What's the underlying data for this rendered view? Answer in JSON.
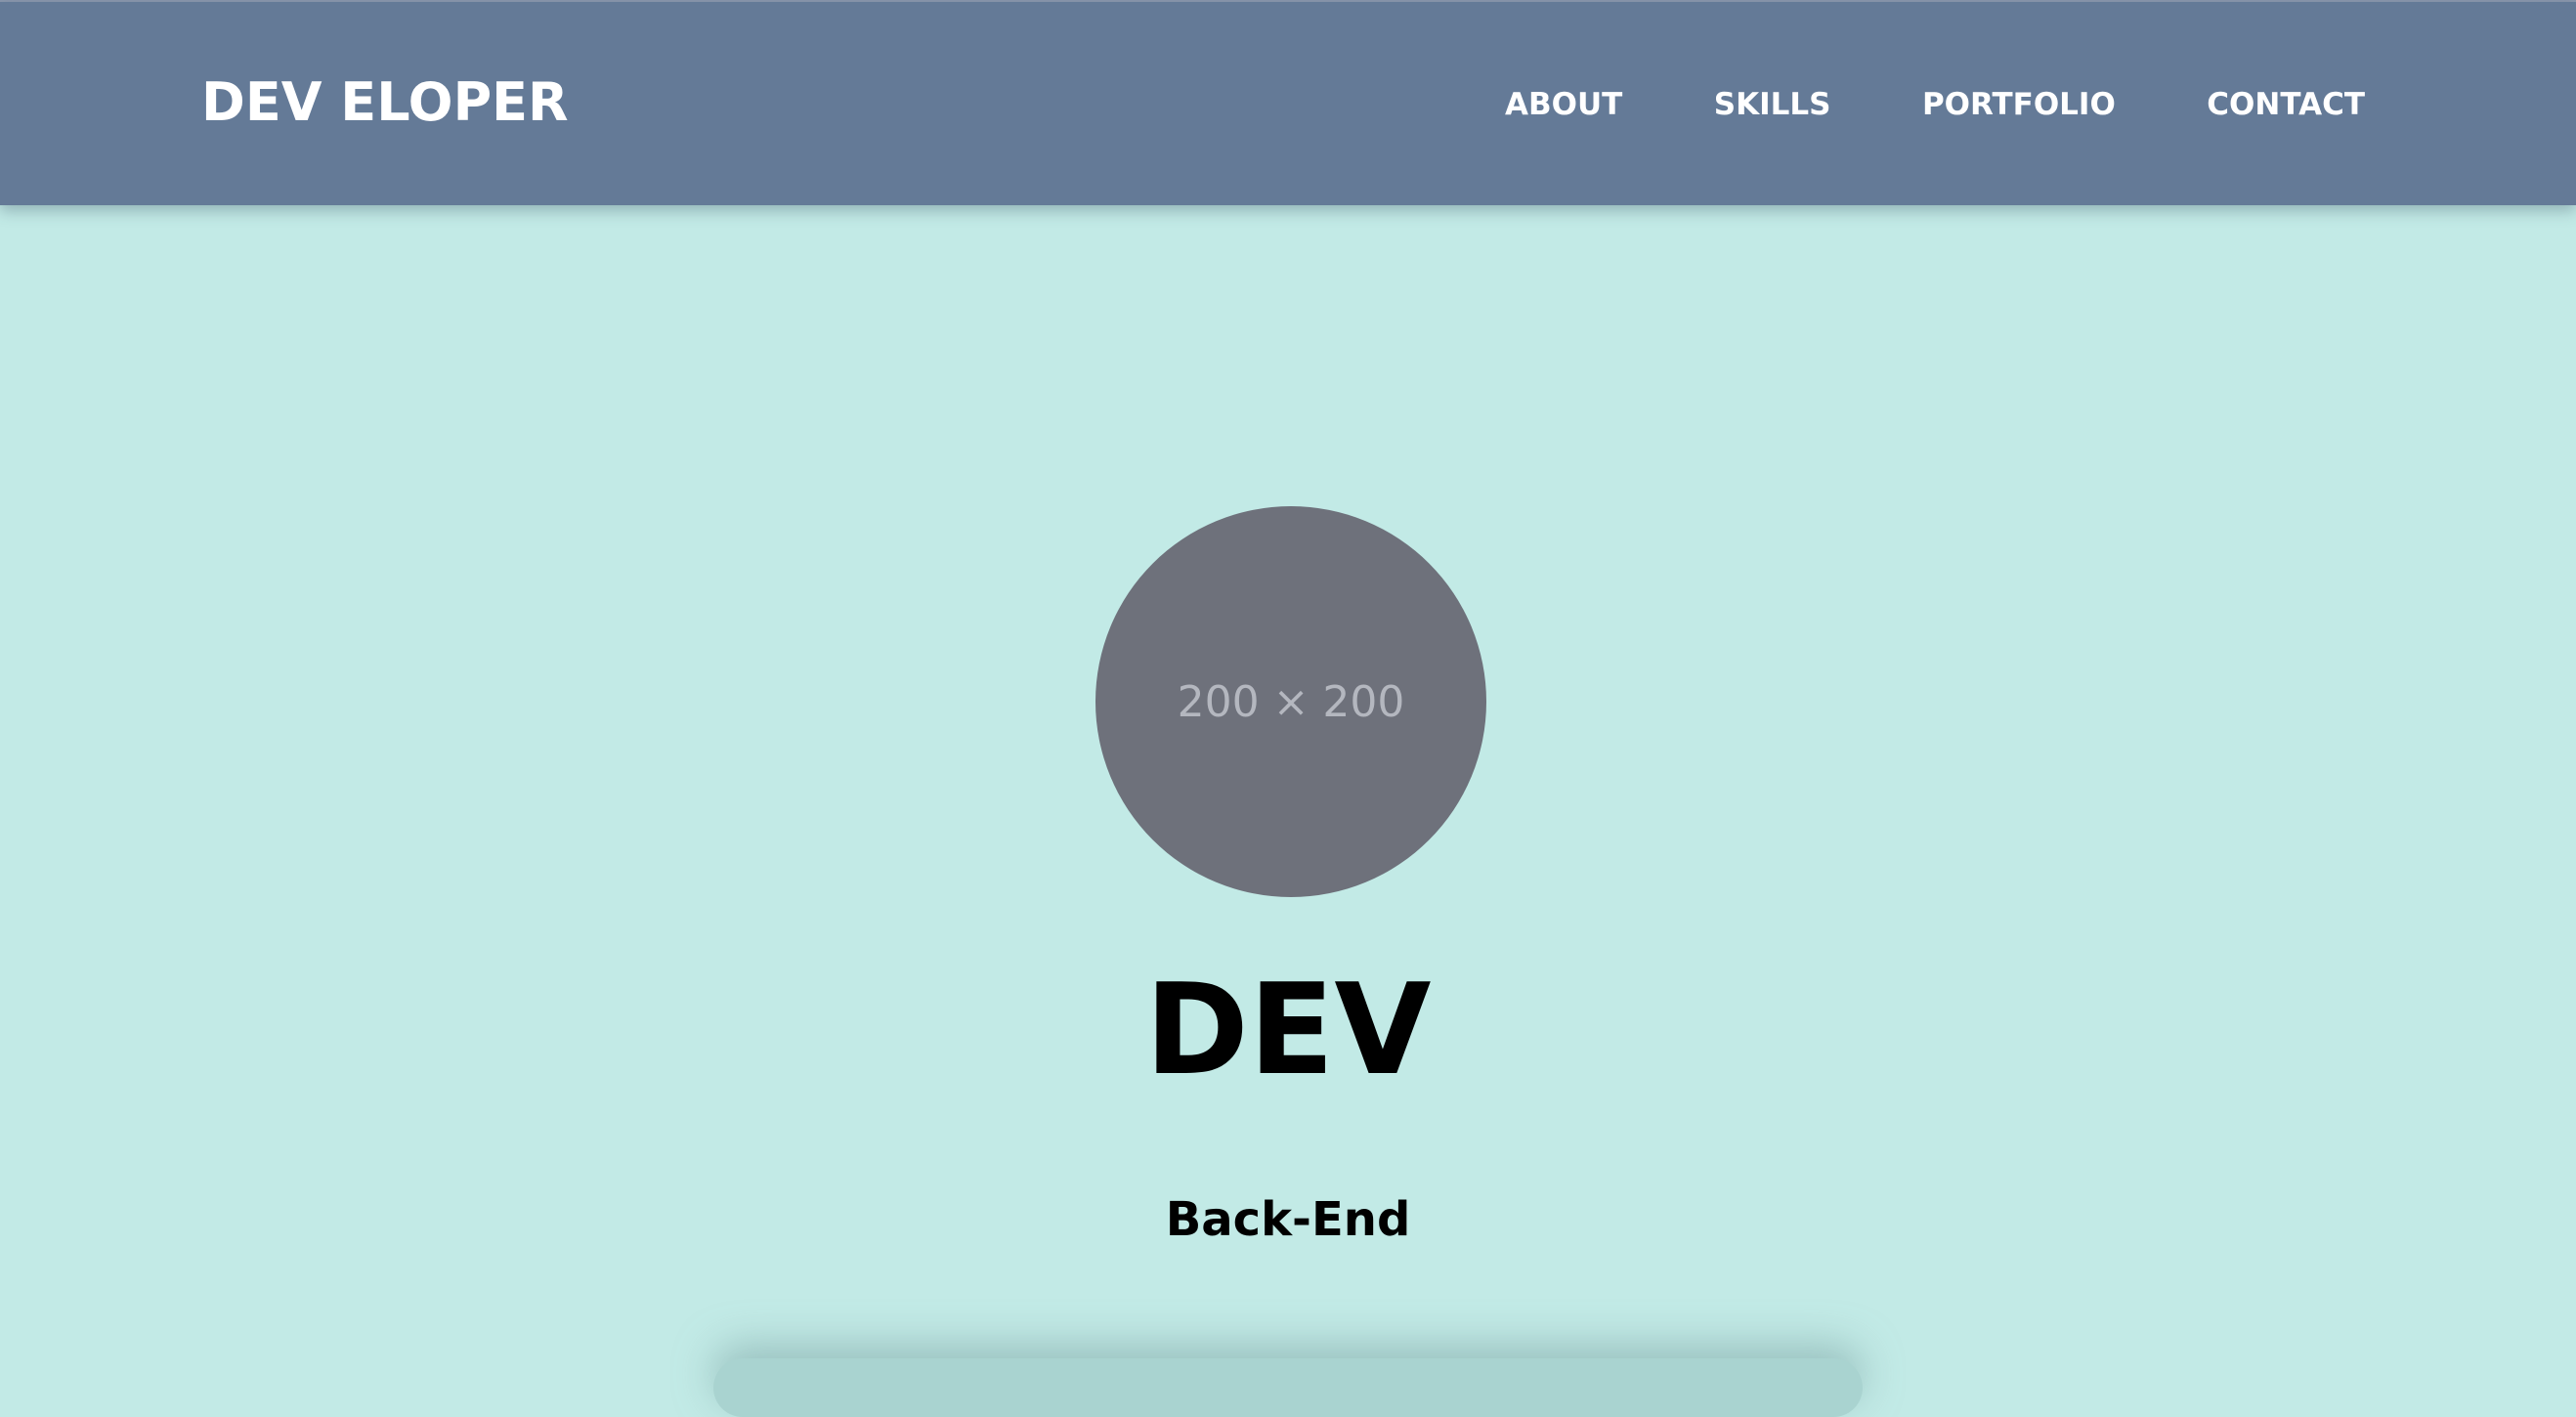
{
  "brand": {
    "title": "DEV ELOPER"
  },
  "nav": {
    "items": [
      {
        "label": "ABOUT"
      },
      {
        "label": "SKILLS"
      },
      {
        "label": "PORTFOLIO"
      },
      {
        "label": "CONTACT"
      }
    ]
  },
  "hero": {
    "avatar_placeholder": "200 × 200",
    "title": "DEV",
    "subtitle": "Back-End"
  },
  "colors": {
    "navbar": "#647a97",
    "background": "#c2eae6",
    "avatar": "#6e717b",
    "text": "#000000",
    "nav_text": "#ffffff"
  }
}
